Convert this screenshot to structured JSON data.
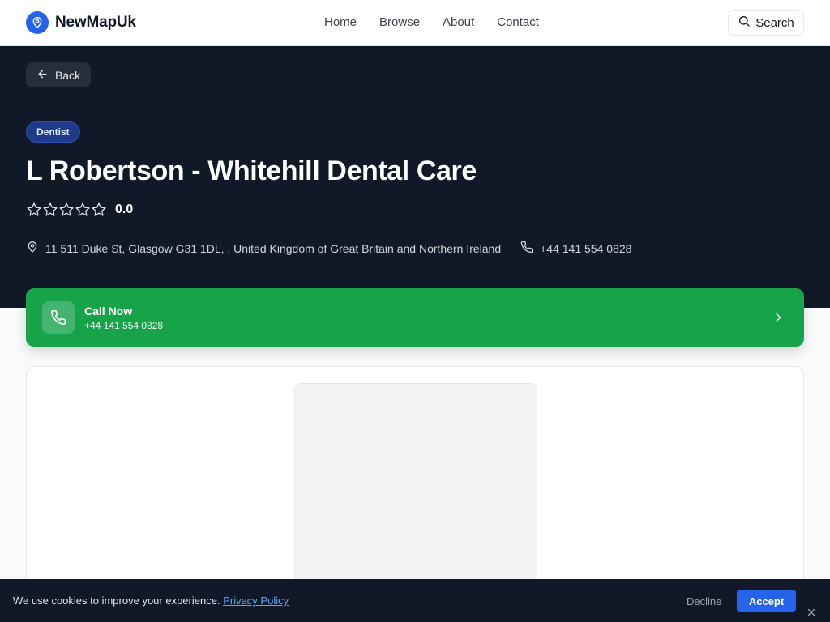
{
  "header": {
    "brand_name": "NewMapUk",
    "brand_icon": "map-pin-icon",
    "nav": [
      {
        "label": "Home"
      },
      {
        "label": "Browse"
      },
      {
        "label": "About"
      },
      {
        "label": "Contact"
      }
    ],
    "search_label": "Search"
  },
  "hero": {
    "back_label": "Back",
    "category": "Dentist",
    "title": "L Robertson - Whitehill Dental Care",
    "rating": {
      "stars_filled": 0,
      "stars_total": 5,
      "value": "0.0"
    },
    "address": "11 511 Duke St, Glasgow G31 1DL, , United Kingdom of Great Britain and Northern Ireland",
    "phone": "+44 141 554 0828"
  },
  "call_card": {
    "label": "Call Now",
    "number": "+44 141 554 0828"
  },
  "cookie": {
    "text": "We use cookies to improve your experience.",
    "link": "Privacy Policy",
    "decline": "Decline",
    "accept": "Accept"
  },
  "colors": {
    "brand": "#2563eb",
    "hero_bg": "#111827",
    "call_green": "#16a34a",
    "badge_bg": "#1e3a8a"
  }
}
